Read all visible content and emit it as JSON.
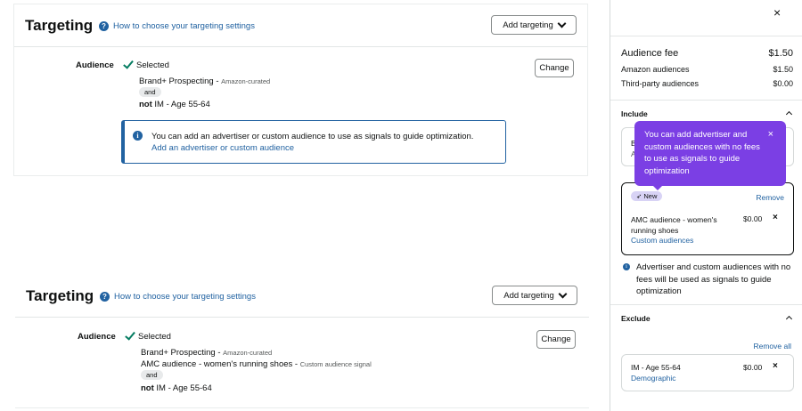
{
  "top": {
    "title": "Targeting",
    "help_link": "How to choose your targeting settings",
    "add_targeting": "Add targeting",
    "audience_label": "Audience",
    "selected": "Selected",
    "lines": [
      {
        "main": "Brand+ Prospecting - ",
        "sub": "Amazon-curated"
      }
    ],
    "and": "and",
    "not_prefix": "not",
    "not_text": " IM - Age 55-64",
    "change": "Change",
    "info_text": "You can add an advertiser or custom audience to use as signals to guide optimization.",
    "info_link": "Add an advertiser or custom audience"
  },
  "bottom": {
    "title": "Targeting",
    "help_link": "How to choose your targeting settings",
    "add_targeting": "Add targeting",
    "audience_label": "Audience",
    "selected": "Selected",
    "line1_main": "Brand+ Prospecting - ",
    "line1_sub": "Amazon-curated",
    "line2_main": "AMC audience - women's running shoes - ",
    "line2_sub": "Custom audience signal",
    "and": "and",
    "not_prefix": "not",
    "not_text": " IM - Age 55-64",
    "change": "Change"
  },
  "panel": {
    "close": "×",
    "fee_label": "Audience fee",
    "fee_value": "$1.50",
    "amazon_label": "Amazon audiences",
    "amazon_value": "$1.50",
    "third_label": "Third-party audiences",
    "third_value": "$0.00",
    "include_title": "Include",
    "hidden_box_initials_1": "B",
    "hidden_box_initials_2": "A",
    "tooltip_text": "You can add advertiser and custom audiences with no fees to use as signals to guide optimization",
    "tooltip_close": "×",
    "new_badge": "New",
    "remove": "Remove",
    "amc_title": "AMC audience - women's running shoes",
    "amc_sub": "Custom audiences",
    "amc_price": "$0.00",
    "remove_x": "×",
    "note": "Advertiser and custom audiences with no fees will be used as signals to guide optimization",
    "exclude_title": "Exclude",
    "remove_all": "Remove all",
    "ex_title": "IM - Age 55-64",
    "ex_sub": "Demographic",
    "ex_price": "$0.00"
  },
  "colors": {
    "accent": "#2162a1",
    "tooltip": "#7b3fe4",
    "check": "#067d62"
  }
}
